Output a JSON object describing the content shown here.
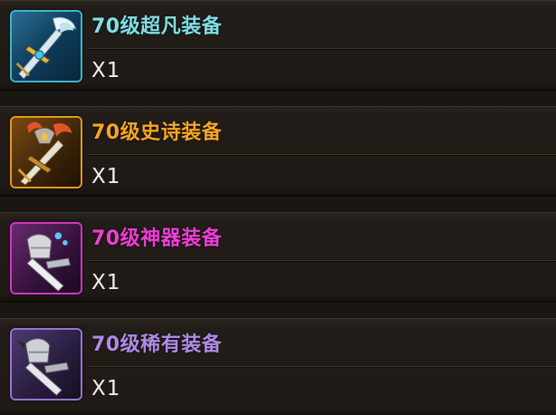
{
  "items": [
    {
      "name": "70级超凡装备",
      "quantity": "X1",
      "name_color": "#7fe0e6",
      "frame_color": "#3fb6c8",
      "icon": "epic-sword-icon",
      "rarity": "superior"
    },
    {
      "name": "70级史诗装备",
      "quantity": "X1",
      "name_color": "#f5a623",
      "frame_color": "#e39a1c",
      "icon": "legendary-sword-icon",
      "rarity": "epic"
    },
    {
      "name": "70级神器装备",
      "quantity": "X1",
      "name_color": "#ee3fd6",
      "frame_color": "#d534c3",
      "icon": "artifact-gauntlet-icon",
      "rarity": "artifact"
    },
    {
      "name": "70级稀有装备",
      "quantity": "X1",
      "name_color": "#b08ae6",
      "frame_color": "#9a73d2",
      "icon": "rare-gauntlet-icon",
      "rarity": "rare"
    }
  ]
}
